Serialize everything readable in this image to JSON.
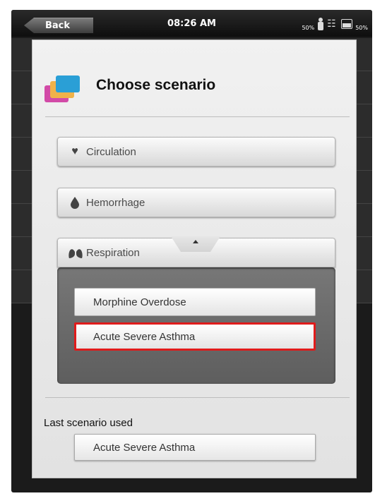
{
  "status_bar": {
    "back_label": "Back",
    "time": "08:26 AM",
    "battery_left": "50%",
    "battery_right": "50%"
  },
  "dialog": {
    "title": "Choose scenario",
    "categories": [
      {
        "label": "Circulation",
        "icon": "heart-icon"
      },
      {
        "label": "Hemorrhage",
        "icon": "drop-icon"
      },
      {
        "label": "Respiration",
        "icon": "lungs-icon",
        "expanded": true
      }
    ],
    "respiration_scenarios": [
      {
        "label": "Morphine Overdose",
        "selected": false
      },
      {
        "label": "Acute Severe Asthma",
        "selected": true
      }
    ],
    "last_used_label": "Last scenario used",
    "last_used_value": "Acute Severe Asthma"
  },
  "colors": {
    "selected_border": "#e01b1b",
    "panel_bg": "#6a6a6a"
  }
}
